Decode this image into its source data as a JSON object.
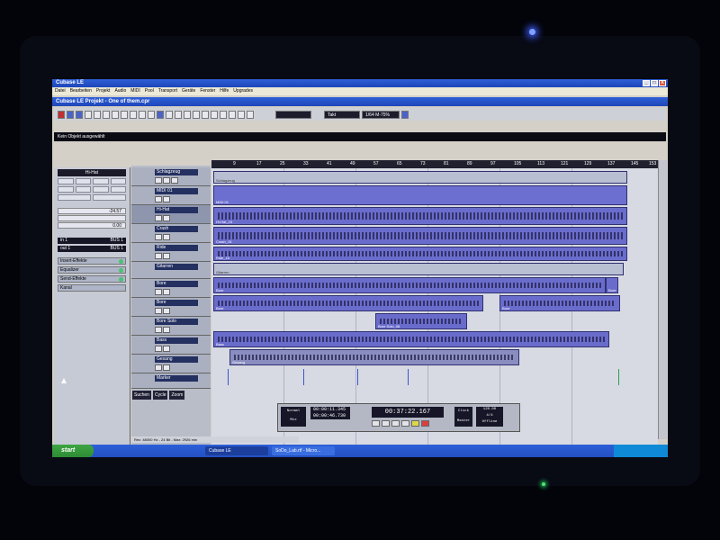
{
  "window": {
    "app_title": "Cubase LE",
    "project_title": "Cubase LE Projekt - One of them.cpr",
    "min": "_",
    "max": "□",
    "close": "X"
  },
  "menu": [
    "Datei",
    "Bearbeiten",
    "Projekt",
    "Audio",
    "MIDI",
    "Pool",
    "Transport",
    "Geräte",
    "Fenster",
    "Hilfe",
    "Upgrades"
  ],
  "toolbar": {
    "snap_value": "Takt",
    "quantize_value": "1/64 M-75%"
  },
  "info_line": "Kein Objekt ausgewählt",
  "inspector": {
    "track_name": "Hi-Hat",
    "volume": "-24.57",
    "pan": "0.00",
    "input": "in 1",
    "input_bus": "BUS 1",
    "output": "out 1",
    "output_bus": "BUS 1",
    "sections": [
      "Insert-Effekte",
      "Equalizer",
      "Send-Effekte",
      "Kanal"
    ]
  },
  "tracks": [
    {
      "name": "Schlagzeug"
    },
    {
      "name": "MIDI 01"
    },
    {
      "name": "Hi-Hat"
    },
    {
      "name": "Crash"
    },
    {
      "name": "Ride"
    },
    {
      "name": "Gitarren"
    },
    {
      "name": "Bore"
    },
    {
      "name": "Bore"
    },
    {
      "name": "Bore Solo"
    },
    {
      "name": "Bass"
    },
    {
      "name": "Gesang"
    },
    {
      "name": "Marker"
    }
  ],
  "marker_controls": [
    "Suchen",
    "Cycle",
    "Zoom"
  ],
  "ruler_ticks": [
    "9",
    "17",
    "25",
    "33",
    "41",
    "49",
    "57",
    "65",
    "73",
    "81",
    "89",
    "97",
    "105",
    "113",
    "121",
    "129",
    "137",
    "145",
    "153"
  ],
  "parts": {
    "schlagzeug": "Schlagzeug",
    "midi01": "MIDI 01",
    "hihat": "Hi-Hat_15",
    "crash": "Crash_15",
    "ride": "Ride_15",
    "gitarren": "Gitarren",
    "bore1": "Bore",
    "bore1b": "Bore",
    "bore2": "Bore",
    "bore2b": "Bore",
    "boresolo": "Bore Solo_06",
    "bass": "Bass",
    "gesang": "Gesang"
  },
  "transport": {
    "mode": "Normal",
    "mix": "Mix",
    "left_locator": "00:00:11.345",
    "right_locator": "00:00:46.730",
    "position": "00:37:22.167",
    "tempo": "120.00",
    "signature": "4/4",
    "sync": "Offline",
    "click": "Click",
    "master": "Master"
  },
  "status": "Rec: 48000 Hz - 24 Bit - Max: 2926 min",
  "taskbar": {
    "start": "start",
    "items": [
      "Cubase LE",
      "SoDo_Lab.rtf - Micro..."
    ]
  }
}
